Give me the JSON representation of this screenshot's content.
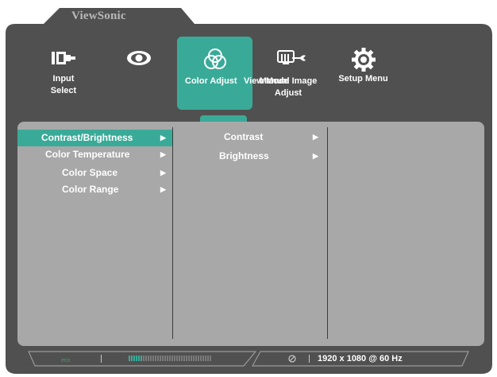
{
  "brand": "ViewSonic",
  "menu": [
    {
      "label": "Input\nSelect",
      "icon": "input-select-icon"
    },
    {
      "label": "",
      "icon": "eye-icon"
    },
    {
      "label": "Color Adjust",
      "icon": "color-circles-icon"
    },
    {
      "label": "View Mode",
      "icon": ""
    },
    {
      "label": "Manual Image\nAdjust",
      "icon": "monitor-wrench-icon"
    },
    {
      "label": "Setup Menu",
      "icon": "gear-icon"
    }
  ],
  "submenu": [
    {
      "label": "Contrast/Brightness",
      "selected": true
    },
    {
      "label": "Color Temperature",
      "selected": false
    },
    {
      "label": "Color Space",
      "selected": false
    },
    {
      "label": "Color Range",
      "selected": false
    }
  ],
  "detail": [
    {
      "label": "Contrast"
    },
    {
      "label": "Brightness"
    }
  ],
  "status": {
    "resolution": "1920 x 1080 @ 60 Hz"
  },
  "colors": {
    "accent": "#3aaa98",
    "frame": "#505050",
    "panel": "#a8a8a8"
  }
}
